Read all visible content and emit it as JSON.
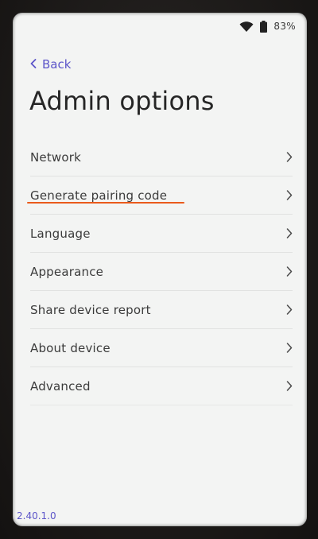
{
  "status_bar": {
    "battery_percent": "83%"
  },
  "header": {
    "back_label": "Back",
    "title": "Admin options"
  },
  "menu": {
    "items": [
      {
        "label": "Network"
      },
      {
        "label": "Generate pairing code"
      },
      {
        "label": "Language"
      },
      {
        "label": "Appearance"
      },
      {
        "label": "Share device report"
      },
      {
        "label": "About device"
      },
      {
        "label": "Advanced"
      }
    ]
  },
  "footer": {
    "version": "2.40.1.0"
  },
  "colors": {
    "accent": "#5c55c9",
    "highlight": "#ea5a1c",
    "background": "#f3f4f3"
  }
}
